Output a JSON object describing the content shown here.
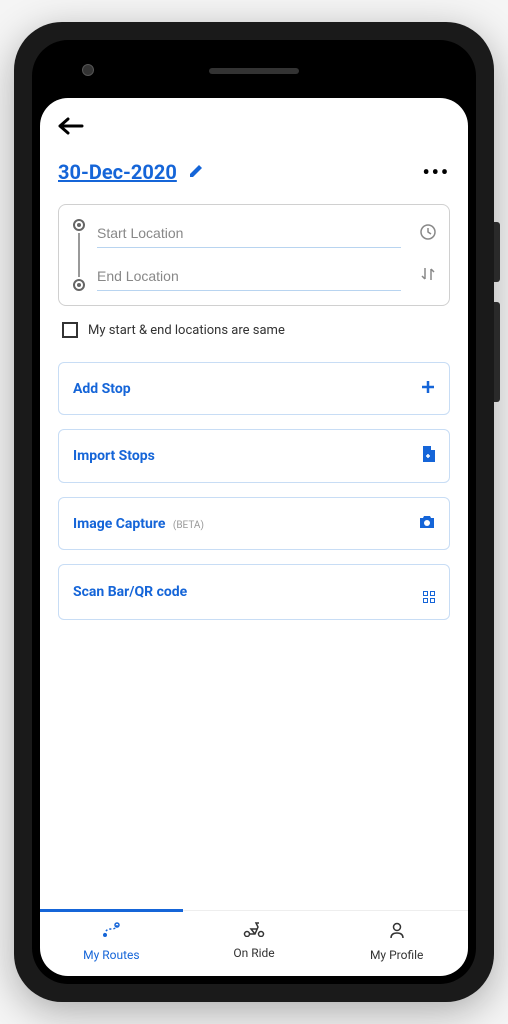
{
  "header": {
    "date": "30-Dec-2020"
  },
  "locations": {
    "start_placeholder": "Start Location",
    "end_placeholder": "End Location",
    "same_label": "My start & end locations are same"
  },
  "actions": {
    "add_stop": "Add Stop",
    "import_stops": "Import Stops",
    "image_capture": "Image Capture",
    "image_capture_tag": "(BETA)",
    "scan_code": "Scan Bar/QR code"
  },
  "nav": {
    "my_routes": "My Routes",
    "on_ride": "On Ride",
    "my_profile": "My Profile"
  },
  "colors": {
    "primary": "#1565d8"
  }
}
